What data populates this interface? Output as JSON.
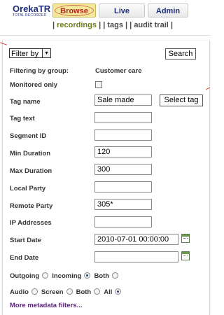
{
  "header": {
    "logo_title": "OrekaTR",
    "logo_subtitle": "TOTAL RECORDER",
    "tabs": [
      {
        "label": "Browse",
        "active": true
      },
      {
        "label": "Live",
        "active": false
      },
      {
        "label": "Admin",
        "active": false
      }
    ]
  },
  "subnav": {
    "items": [
      "recordings",
      "tags",
      "audit trail"
    ],
    "active": "recordings",
    "separator": "|"
  },
  "toolbar": {
    "filter_by_label": "Filter by",
    "filter_dropdown_glyph": "▾",
    "search_label": "Search"
  },
  "form": {
    "filtering_by_group_label": "Filtering by group:",
    "filtering_by_group_value": "Customer care",
    "monitored_only_label": "Monitored only",
    "monitored_only_checked": false,
    "tag_name_label": "Tag name",
    "tag_name_value": "Sale made",
    "select_tag_label": "Select tag",
    "tag_text_label": "Tag text",
    "tag_text_value": "",
    "segment_id_label": "Segment ID",
    "segment_id_value": "",
    "min_duration_label": "Min Duration",
    "min_duration_value": "120",
    "max_duration_label": "Max Duration",
    "max_duration_value": "300",
    "local_party_label": "Local Party",
    "local_party_value": "",
    "remote_party_label": "Remote Party",
    "remote_party_value": "305*",
    "ip_addresses_label": "IP Addresses",
    "ip_addresses_value": "",
    "start_date_label": "Start Date",
    "start_date_value": "2010-07-01 00:00:00",
    "end_date_label": "End Date",
    "end_date_value": ""
  },
  "direction": {
    "options": [
      {
        "label": "Outgoing",
        "checked": false
      },
      {
        "label": "Incoming",
        "checked": true
      },
      {
        "label": "Both",
        "checked": false
      }
    ]
  },
  "media": {
    "options": [
      {
        "label": "Audio",
        "checked": false
      },
      {
        "label": "Screen",
        "checked": false
      },
      {
        "label": "Both",
        "checked": false
      },
      {
        "label": "All",
        "checked": true
      }
    ]
  },
  "more_filters_label": "More metadata filters...",
  "icons": {
    "calendar": "calendar-icon",
    "dropdown": "chevron-down-icon"
  },
  "colors": {
    "brand_navy": "#1f2f7a",
    "browse_tab_bg": "#f3e79a",
    "browse_tab_text": "#b22222",
    "subnav_active": "#6b7f1f",
    "link_purple": "#5b1f7a"
  }
}
